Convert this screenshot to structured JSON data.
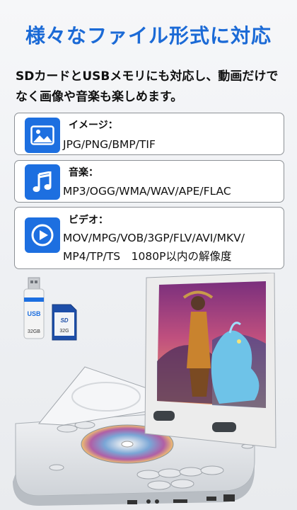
{
  "headline": "様々なファイル形式に対応",
  "subtitle": "SDカードとUSBメモリにも対応し、動画だけでなく画像や音楽も楽しめます。",
  "cards": [
    {
      "icon": "image-icon",
      "label": "イメージ：",
      "lines": [
        "JPG/PNG/BMP/TIF"
      ]
    },
    {
      "icon": "music-note-icon",
      "label": "音楽：",
      "lines": [
        "MP3/OGG/WMA/WAV/APE/FLAC"
      ]
    },
    {
      "icon": "play-circle-icon",
      "label": "ビデオ：",
      "lines": [
        "MOV/MPG/VOB/3GP/FLV/AVI/MKV/",
        "MP4/TP/TS　1080P以内の解像度"
      ]
    }
  ],
  "usb_stick": {
    "brand": "USB",
    "capacity": "32GB"
  },
  "sd_card": {
    "label": "SD",
    "capacity": "32G"
  },
  "colors": {
    "accent": "#1b6ad6",
    "icon_bg": "#1d6fe0",
    "card_border": "#8d9196"
  }
}
